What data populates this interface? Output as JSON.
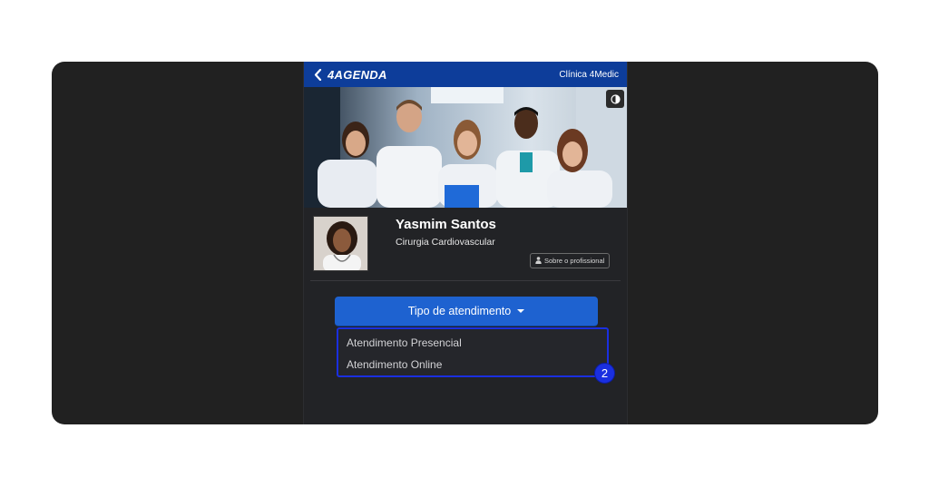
{
  "header": {
    "brand": "4AGENDA",
    "clinic": "Clínica 4Medic"
  },
  "icons": {
    "back": "chevron-left-icon",
    "theme": "contrast-icon",
    "about": "user-icon"
  },
  "profile": {
    "name": "Yasmim Santos",
    "specialty": "Cirurgia Cardiovascular",
    "about_label": "Sobre o profissional"
  },
  "appointment": {
    "dropdown_label": "Tipo de atendimento",
    "options": [
      "Atendimento Presencial",
      "Atendimento Online"
    ]
  },
  "annotation": {
    "step": "2"
  },
  "colors": {
    "header_bg": "#0d3d9a",
    "primary_button": "#1e62d0",
    "highlight": "#1a2fe0",
    "panel_bg": "#222326"
  }
}
